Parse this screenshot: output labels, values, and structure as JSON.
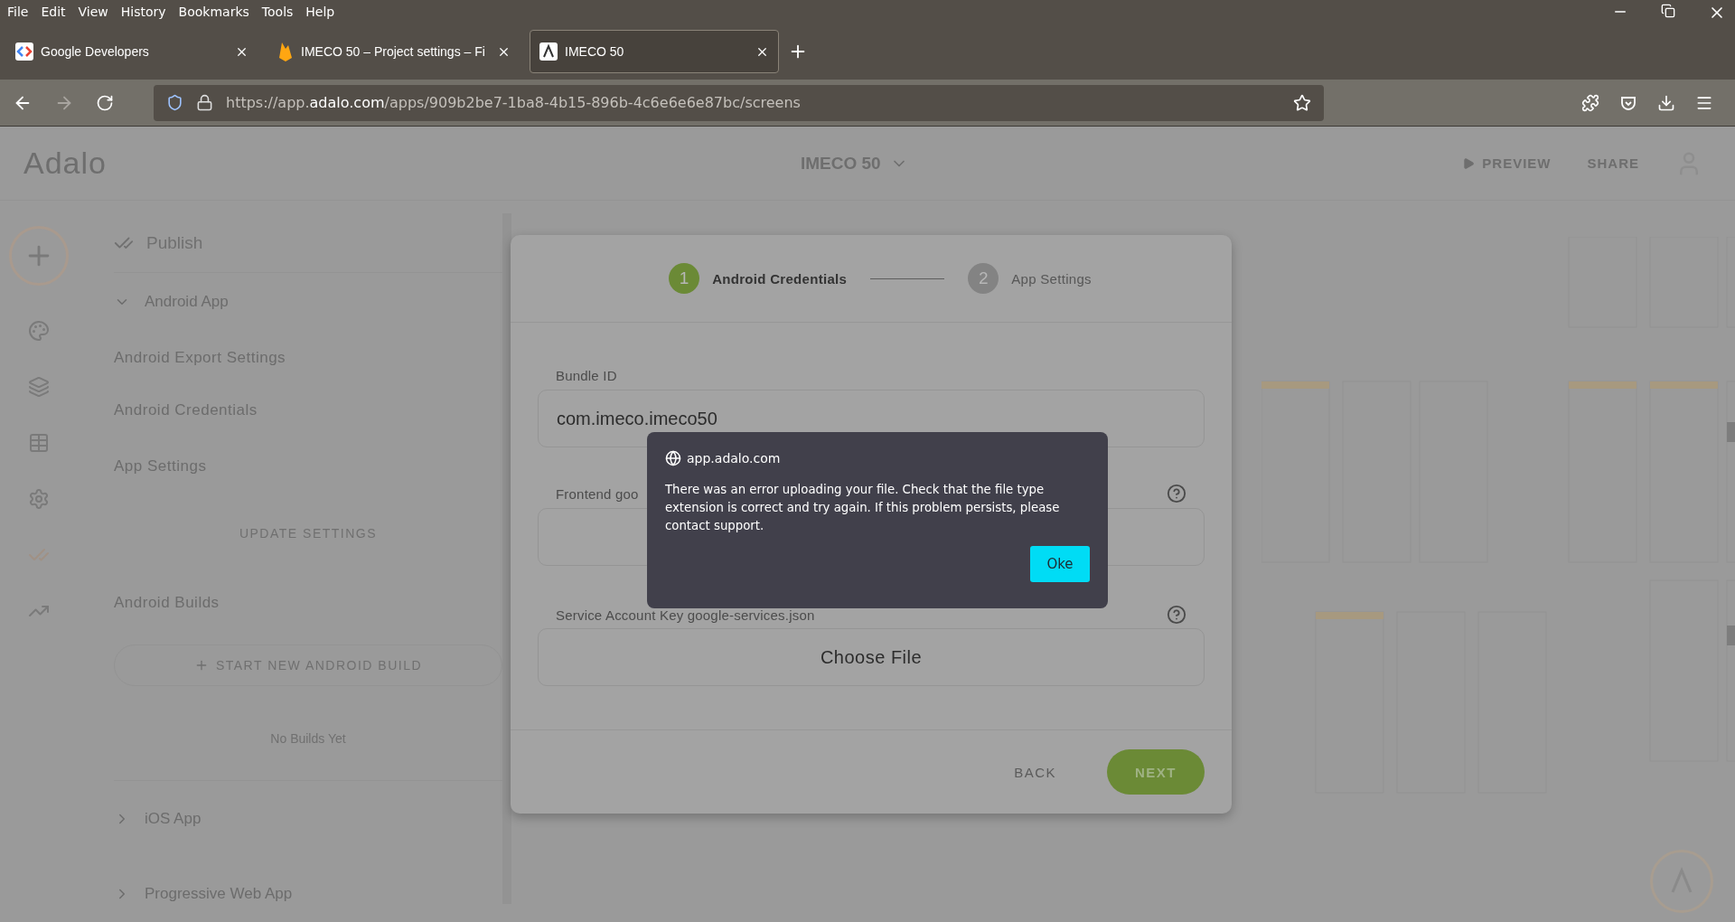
{
  "menu_bar": [
    "File",
    "Edit",
    "View",
    "History",
    "Bookmarks",
    "Tools",
    "Help"
  ],
  "tabs": [
    {
      "kind": "google",
      "title": "Google Developers",
      "selected": false
    },
    {
      "kind": "firebase",
      "title": "IMECO 50 – Project settings – Fi",
      "selected": false
    },
    {
      "kind": "adalo",
      "title": "IMECO 50",
      "selected": true
    }
  ],
  "address_bar": {
    "prefix": "https://app.",
    "domain": "adalo.com",
    "suffix": "/apps/909b2be7-1ba8-4b15-896b-4c6e6e6e87bc/screens"
  },
  "app_header": {
    "logo": "Adalo",
    "app_name": "IMECO 50",
    "preview": "PREVIEW",
    "share": "SHARE"
  },
  "sidebar": {
    "title": "Publish",
    "sections": [
      {
        "label": "Android App",
        "expanded": true,
        "items": [
          "Android Export Settings",
          "Android Credentials",
          "App Settings"
        ],
        "update_button": "UPDATE SETTINGS",
        "builds_title": "Android Builds",
        "build_button": "START NEW ANDROID BUILD",
        "empty_text": "No Builds Yet"
      },
      {
        "label": "iOS App",
        "expanded": false
      },
      {
        "label": "Progressive Web App",
        "expanded": false
      }
    ]
  },
  "wizard": {
    "steps": [
      {
        "number": "1",
        "label": "Android Credentials",
        "selected": true
      },
      {
        "number": "2",
        "label": "App Settings",
        "selected": false
      }
    ],
    "fields": [
      {
        "kind": "text",
        "label": "Bundle ID",
        "value": "com.imeco.imeco50"
      },
      {
        "kind": "file",
        "label": "Frontend goo",
        "help": true
      },
      {
        "kind": "file",
        "label": "Service Account Key google-services.json",
        "help": true,
        "button": "Choose File"
      }
    ],
    "back": "BACK",
    "next": "NEXT"
  },
  "alert": {
    "origin": "app.adalo.com",
    "message": "There was an error uploading your file. Check that the file type extension is correct and try again. If this problem persists, please contact support.",
    "button": "Oke"
  }
}
